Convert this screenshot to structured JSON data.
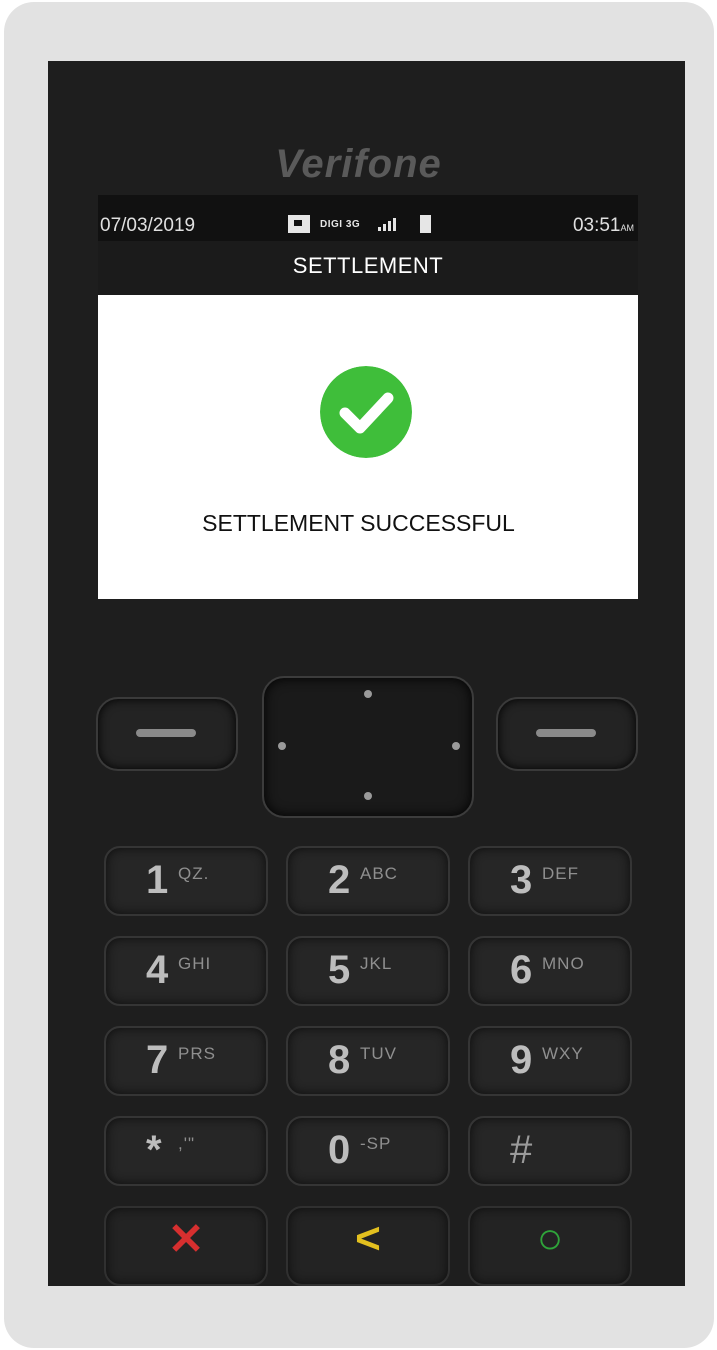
{
  "device": {
    "brand": "Verifone"
  },
  "status_bar": {
    "date": "07/03/2019",
    "network": "DIGI 3G",
    "time": "03:51",
    "time_suffix": "AM"
  },
  "screen": {
    "title": "SETTLEMENT",
    "message": "SETTLEMENT SUCCESSFUL",
    "check_color": "#3fbe3a"
  },
  "keypad": {
    "keys": [
      {
        "digit": "1",
        "letters": "QZ."
      },
      {
        "digit": "2",
        "letters": "ABC"
      },
      {
        "digit": "3",
        "letters": "DEF"
      },
      {
        "digit": "4",
        "letters": "GHI"
      },
      {
        "digit": "5",
        "letters": "JKL"
      },
      {
        "digit": "6",
        "letters": "MNO"
      },
      {
        "digit": "7",
        "letters": "PRS"
      },
      {
        "digit": "8",
        "letters": "TUV"
      },
      {
        "digit": "9",
        "letters": "WXY"
      },
      {
        "digit": "*",
        "letters": ",'\""
      },
      {
        "digit": "0",
        "letters": "-SP"
      },
      {
        "digit": "#",
        "letters": ""
      }
    ],
    "function_keys": [
      {
        "glyph": "✕",
        "color": "#d62f2f"
      },
      {
        "glyph": "<",
        "color": "#e3c01f"
      },
      {
        "glyph": "○",
        "color": "#2fa43a"
      }
    ]
  }
}
